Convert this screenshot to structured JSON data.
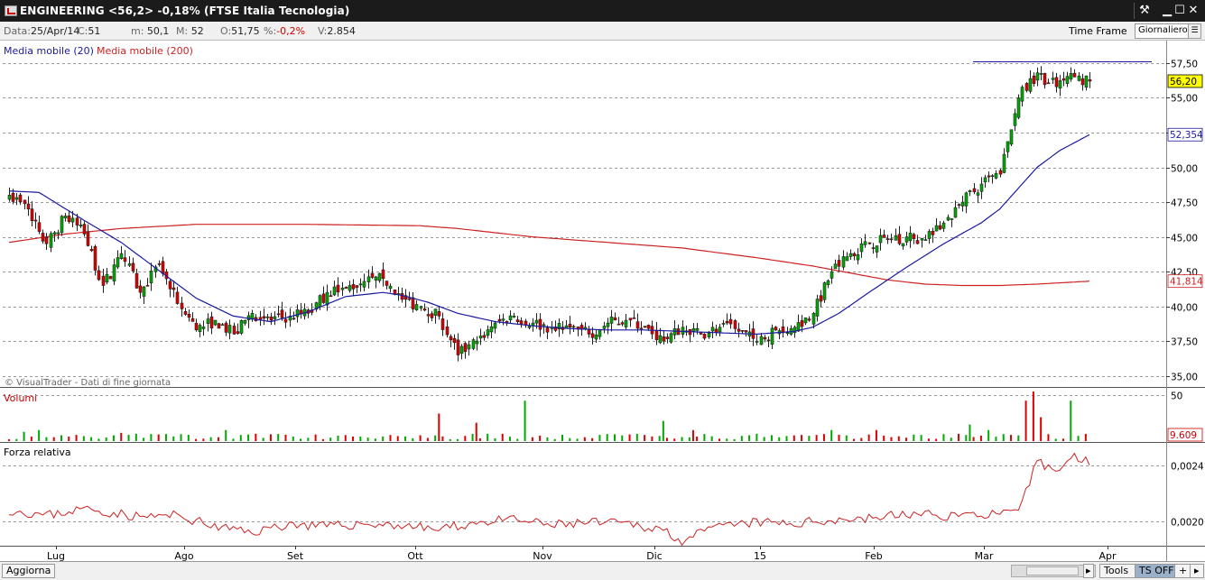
{
  "window": {
    "title": "ENGINEERING <56,2> -0,18% (FTSE Italia Tecnologia)",
    "buttons": {
      "tools": "⚒",
      "minimize": "▁",
      "maximize": "☐",
      "close": "✕"
    }
  },
  "info": {
    "data_label": "Data:",
    "data_value": "25/Apr/14",
    "c_label": "C:",
    "c_value": "51",
    "m_label": "m:",
    "m_value": "50,1",
    "M_label": "M:",
    "M_value": "52",
    "o_label": "O:",
    "o_value": "51,75",
    "pct_label": "%:",
    "pct_value": "-0,2%",
    "v_label": "V:",
    "v_value": "2.854",
    "time_frame_label": "Time Frame",
    "time_frame_value": "Giornaliero"
  },
  "status": {
    "update_label": "Aggiorna",
    "tools_label": "Tools",
    "ts_label": "TS OFF",
    "plus_label": "+",
    "more_label": "▸"
  },
  "colors": {
    "up": "#00aa00",
    "down": "#dd0000",
    "ma20": "#1a1aa0",
    "ma200": "#cc2222",
    "grid": "#999999",
    "last_price_bg": "#ffff00"
  },
  "chart_data": {
    "type": "candlestick",
    "ticker": "ENGINEERING",
    "title": "ENGINEERING <56,2> -0,18% (FTSE Italia Tecnologia)",
    "watermark": "© VisualTrader - Dati di fine giornata",
    "x_labels": [
      "Lug",
      "Ago",
      "Set",
      "Ott",
      "Nov",
      "Dic",
      "15",
      "Feb",
      "Mar",
      "Apr"
    ],
    "price_panel": {
      "ylim": [
        34.2,
        58.6
      ],
      "y_ticks": [
        "57,50",
        "55,00",
        "52,50",
        "50,00",
        "47,50",
        "45,00",
        "42,50",
        "40,00",
        "37,50",
        "35,00"
      ],
      "y_values": [
        57.5,
        55,
        52.5,
        50,
        47.5,
        45,
        42.5,
        40,
        37.5,
        35
      ],
      "last_price": "56,20",
      "ma20_last": "52,354",
      "ma200_last": "41,814",
      "resistance": 57.6,
      "legend": [
        "Media mobile (20)",
        "Media mobile (200)"
      ],
      "close_anchors": [
        [
          0,
          48.0
        ],
        [
          5,
          47.0
        ],
        [
          10,
          44.5
        ],
        [
          15,
          46.5
        ],
        [
          20,
          45.2
        ],
        [
          25,
          41.5
        ],
        [
          30,
          43.8
        ],
        [
          35,
          41.0
        ],
        [
          40,
          43.0
        ],
        [
          45,
          40.2
        ],
        [
          50,
          38.3
        ],
        [
          55,
          39.0
        ],
        [
          60,
          38.0
        ],
        [
          65,
          39.5
        ],
        [
          70,
          39.0
        ],
        [
          75,
          39.3
        ],
        [
          80,
          39.5
        ],
        [
          85,
          41.0
        ],
        [
          90,
          41.3
        ],
        [
          95,
          41.8
        ],
        [
          100,
          42.0
        ],
        [
          105,
          40.5
        ],
        [
          110,
          40.0
        ],
        [
          115,
          39.3
        ],
        [
          120,
          36.5
        ],
        [
          125,
          37.5
        ],
        [
          130,
          38.8
        ],
        [
          135,
          39.3
        ],
        [
          140,
          38.8
        ],
        [
          145,
          38.5
        ],
        [
          150,
          38.5
        ],
        [
          155,
          38.0
        ],
        [
          160,
          38.8
        ],
        [
          165,
          39.0
        ],
        [
          170,
          38.5
        ],
        [
          175,
          37.5
        ],
        [
          180,
          38.5
        ],
        [
          185,
          38.0
        ],
        [
          190,
          38.5
        ],
        [
          195,
          38.2
        ],
        [
          200,
          37.5
        ],
        [
          205,
          38.3
        ],
        [
          210,
          38.5
        ],
        [
          215,
          39.5
        ],
        [
          220,
          42.5
        ],
        [
          225,
          43.8
        ],
        [
          230,
          44.5
        ],
        [
          235,
          44.8
        ],
        [
          240,
          45.0
        ],
        [
          245,
          44.8
        ],
        [
          250,
          46.0
        ],
        [
          255,
          47.5
        ],
        [
          260,
          48.8
        ],
        [
          265,
          49.5
        ],
        [
          270,
          55.0
        ],
        [
          275,
          56.8
        ],
        [
          280,
          55.8
        ],
        [
          285,
          56.5
        ],
        [
          289,
          56.2
        ]
      ],
      "ma20_anchors": [
        [
          0,
          48.3
        ],
        [
          8,
          48.2
        ],
        [
          20,
          46.2
        ],
        [
          30,
          44.6
        ],
        [
          40,
          42.6
        ],
        [
          50,
          40.6
        ],
        [
          60,
          39.3
        ],
        [
          70,
          38.9
        ],
        [
          80,
          39.6
        ],
        [
          90,
          40.7
        ],
        [
          100,
          41.0
        ],
        [
          105,
          40.8
        ],
        [
          112,
          40.3
        ],
        [
          120,
          39.5
        ],
        [
          130,
          38.9
        ],
        [
          140,
          38.6
        ],
        [
          150,
          38.4
        ],
        [
          160,
          38.3
        ],
        [
          170,
          38.3
        ],
        [
          180,
          38.2
        ],
        [
          190,
          38.1
        ],
        [
          200,
          38.0
        ],
        [
          210,
          38.2
        ],
        [
          215,
          38.5
        ],
        [
          222,
          39.5
        ],
        [
          230,
          41.0
        ],
        [
          240,
          42.8
        ],
        [
          250,
          44.5
        ],
        [
          260,
          46.0
        ],
        [
          265,
          47.0
        ],
        [
          270,
          48.5
        ],
        [
          275,
          50.0
        ],
        [
          281,
          51.2
        ],
        [
          289,
          52.35
        ]
      ],
      "ma200_anchors": [
        [
          0,
          44.6
        ],
        [
          15,
          45.2
        ],
        [
          30,
          45.6
        ],
        [
          50,
          45.9
        ],
        [
          80,
          45.9
        ],
        [
          110,
          45.8
        ],
        [
          120,
          45.6
        ],
        [
          140,
          45.0
        ],
        [
          160,
          44.6
        ],
        [
          180,
          44.2
        ],
        [
          200,
          43.5
        ],
        [
          215,
          42.9
        ],
        [
          225,
          42.4
        ],
        [
          235,
          41.9
        ],
        [
          245,
          41.6
        ],
        [
          255,
          41.5
        ],
        [
          265,
          41.5
        ],
        [
          275,
          41.6
        ],
        [
          289,
          41.81
        ]
      ]
    },
    "volume_panel": {
      "title": "Volumi",
      "y_tick": "50",
      "last_value": "9.609",
      "spikes": [
        [
          4,
          10
        ],
        [
          8,
          12
        ],
        [
          30,
          9
        ],
        [
          58,
          12
        ],
        [
          66,
          8
        ],
        [
          115,
          30
        ],
        [
          125,
          20
        ],
        [
          138,
          44
        ],
        [
          175,
          22
        ],
        [
          183,
          12
        ],
        [
          200,
          8
        ],
        [
          220,
          12
        ],
        [
          232,
          12
        ],
        [
          257,
          18
        ],
        [
          262,
          12
        ],
        [
          272,
          44
        ],
        [
          274,
          54
        ],
        [
          276,
          26
        ],
        [
          284,
          44
        ]
      ]
    },
    "relative_strength_panel": {
      "title": "Forza relativa",
      "y_ticks": [
        "0,0024",
        "0,0020"
      ],
      "y_values": [
        0.0024,
        0.002
      ],
      "ylim": [
        0.00183,
        0.00256
      ]
    }
  }
}
